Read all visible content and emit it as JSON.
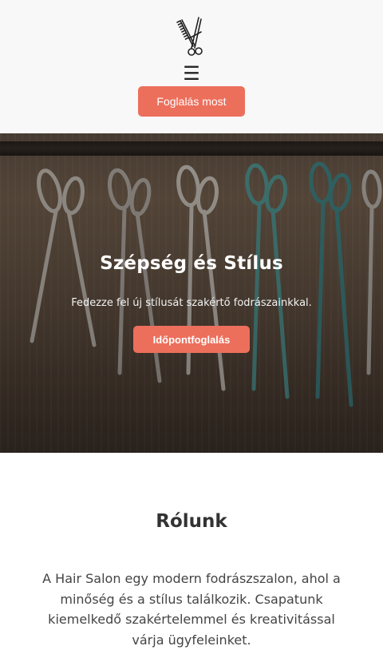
{
  "header": {
    "logo_icon": "scissors-comb-icon",
    "menu_icon": "☰",
    "cta_label": "Foglalás most",
    "accent_color": "#ec6f5c"
  },
  "hero": {
    "title": "Szépség és Stílus",
    "subtitle": "Fedezze fel új stílusát szakértő fodrászainkkal.",
    "button_label": "Időpontfoglalás"
  },
  "about": {
    "title": "Rólunk",
    "text": "A Hair Salon egy modern fodrászszalon, ahol a minőség és a stílus találkozik. Csapatunk kiemelkedő szakértelemmel és kreativitással várja ügyfeleinket."
  }
}
